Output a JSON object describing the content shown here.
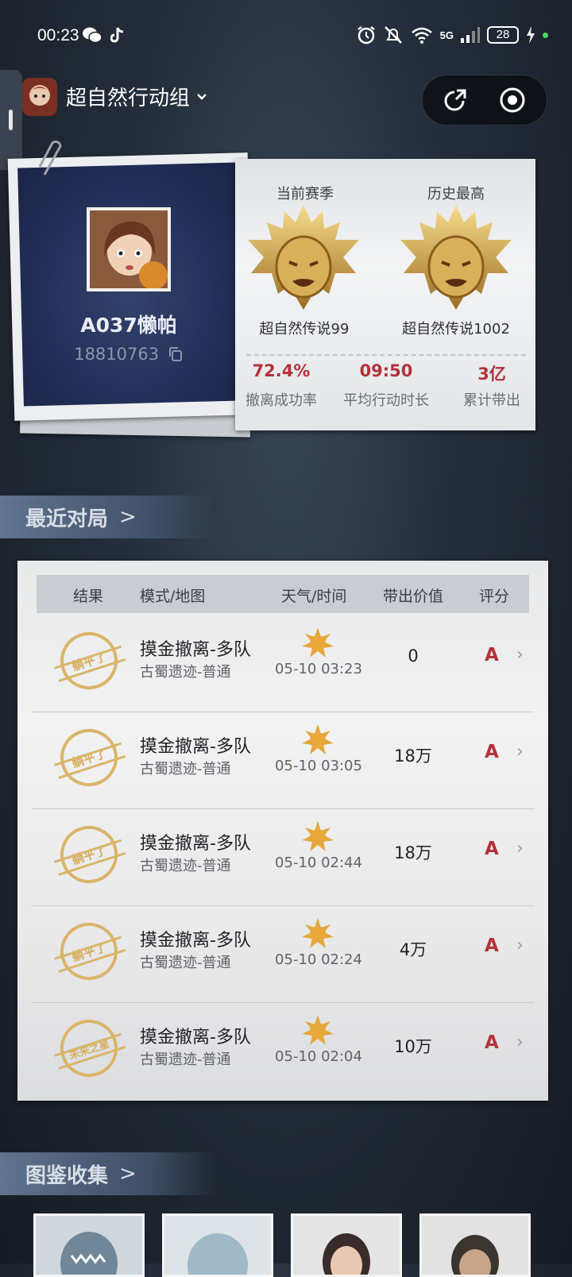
{
  "status_bar": {
    "time": "00:23",
    "network": "5G",
    "battery": "28"
  },
  "header": {
    "team_name": "超自然行动组",
    "dropdown_icon": "chevron-down-icon",
    "share_icon": "share-icon",
    "record_icon": "record-icon"
  },
  "profile": {
    "player_name": "A037懒帕",
    "player_id": "18810763",
    "copy_icon": "copy-icon"
  },
  "ranks": {
    "current": {
      "label": "当前赛季",
      "name": "超自然传说99"
    },
    "best": {
      "label": "历史最高",
      "name": "超自然传说1002"
    }
  },
  "stats": [
    {
      "value": "72.4%",
      "label": "撤离成功率"
    },
    {
      "value": "09:50",
      "label": "平均行动时长"
    },
    {
      "value": "3亿",
      "label": "累计带出"
    }
  ],
  "recent_section": {
    "title": "最近对局",
    "chevron": ">"
  },
  "table": {
    "headers": [
      "结果",
      "模式/地图",
      "天气/时间",
      "带出价值",
      "评分"
    ],
    "rows": [
      {
        "stamp": "躺平了",
        "mode": "摸金撤离-多队",
        "map": "古蜀遗迹-普通",
        "time": "05-10 03:23",
        "value": "0",
        "grade": "A"
      },
      {
        "stamp": "躺平了",
        "mode": "摸金撤离-多队",
        "map": "古蜀遗迹-普通",
        "time": "05-10 03:05",
        "value": "18万",
        "grade": "A"
      },
      {
        "stamp": "躺平了",
        "mode": "摸金撤离-多队",
        "map": "古蜀遗迹-普通",
        "time": "05-10 02:44",
        "value": "18万",
        "grade": "A"
      },
      {
        "stamp": "躺平了",
        "mode": "摸金撤离-多队",
        "map": "古蜀遗迹-普通",
        "time": "05-10 02:24",
        "value": "4万",
        "grade": "A"
      },
      {
        "stamp": "未来之星",
        "mode": "摸金撤离-多队",
        "map": "古蜀遗迹-普通",
        "time": "05-10 02:04",
        "value": "10万",
        "grade": "A"
      }
    ]
  },
  "collection_section": {
    "title": "图鉴收集",
    "chevron": ">"
  },
  "colors": {
    "accent_red": "#b4323a",
    "stamp_gold": "#d9b56a",
    "profile_navy": "#24305a"
  }
}
